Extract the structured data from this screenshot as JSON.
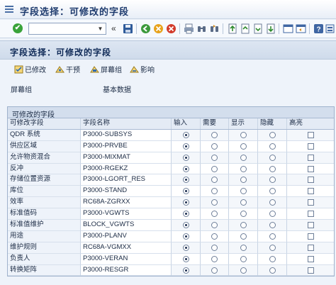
{
  "window": {
    "title": "字段选择：可修改的字段"
  },
  "toolbar": {
    "command_value": "",
    "icons": [
      "enter-icon",
      "save-icon",
      "back-icon",
      "exit-icon",
      "cancel-icon",
      "print-icon",
      "find-icon",
      "find-next-icon",
      "first-page-icon",
      "previous-page-icon",
      "next-page-icon",
      "last-page-icon",
      "new-session-icon",
      "shortcut-icon",
      "help-icon",
      "layout-icon"
    ],
    "overflow": "«"
  },
  "screen": {
    "title": "字段选择：可修改的字段"
  },
  "app_toolbar": [
    {
      "label": "已修改",
      "icon": "changed-icon"
    },
    {
      "label": "干预",
      "icon": "influence-icon"
    },
    {
      "label": "屏幕组",
      "icon": "screen-group-icon"
    },
    {
      "label": "影响",
      "icon": "effect-icon"
    }
  ],
  "info": {
    "label": "屏幕组",
    "value": "基本数据"
  },
  "table": {
    "title": "可修改的字段",
    "headers": [
      "可修改字段",
      "字段名称",
      "输入",
      "需要",
      "显示",
      "隐藏",
      "高亮"
    ],
    "rows": [
      {
        "label": "QDR 系统",
        "field": "P3000-SUBSYS",
        "selected": "input",
        "highlight": false
      },
      {
        "label": "供应区域",
        "field": "P3000-PRVBE",
        "selected": "input",
        "highlight": false
      },
      {
        "label": "允许物资混合",
        "field": "P3000-MIXMAT",
        "selected": "input",
        "highlight": false
      },
      {
        "label": "反冲",
        "field": "P3000-RGEKZ",
        "selected": "input",
        "highlight": false
      },
      {
        "label": "存储位置资源",
        "field": "P3000-LGORT_RES",
        "selected": "input",
        "highlight": false
      },
      {
        "label": "库位",
        "field": "P3000-STAND",
        "selected": "input",
        "highlight": false
      },
      {
        "label": "效率",
        "field": "RC68A-ZGRXX",
        "selected": "input",
        "highlight": false
      },
      {
        "label": "标准值码",
        "field": "P3000-VGWTS",
        "selected": "input",
        "highlight": false
      },
      {
        "label": "标准值维护",
        "field": "BLOCK_VGWTS",
        "selected": "input",
        "highlight": false
      },
      {
        "label": "用途",
        "field": "P3000-PLANV",
        "selected": "input",
        "highlight": false
      },
      {
        "label": "维护规则",
        "field": "RC68A-VGMXX",
        "selected": "input",
        "highlight": false
      },
      {
        "label": "负责人",
        "field": "P3000-VERAN",
        "selected": "input",
        "highlight": false
      },
      {
        "label": "转换矩阵",
        "field": "P3000-RESGR",
        "selected": "input",
        "highlight": false
      }
    ]
  },
  "colors": {
    "accent": "#1e3b6e",
    "header_bg": "#d3deed",
    "check_green": "#3aa33a"
  }
}
